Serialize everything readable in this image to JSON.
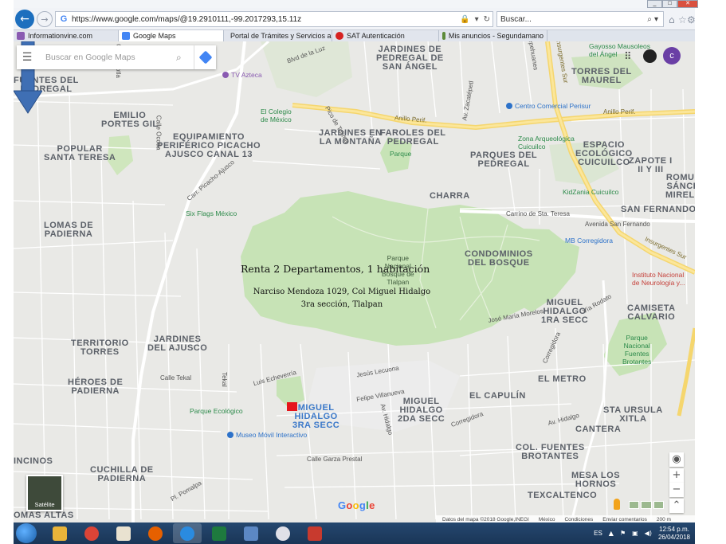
{
  "browser": {
    "url": "https://www.google.com/maps/@19.2910111,-99.2017293,15.11z",
    "search_placeholder": "Buscar...",
    "tabs": [
      {
        "label": "Informationvine.com",
        "color": "#8a5bb2"
      },
      {
        "label": "Google Maps",
        "color": "#4285f4"
      },
      {
        "label": "Portal de Trámites y Servicios a...",
        "color": "#6a85b8"
      },
      {
        "label": "SAT Autenticación",
        "color": "#d62222"
      },
      {
        "label": "Mis anuncios - Segundamano",
        "color": "#5d8b3a"
      }
    ],
    "active_tab": 1
  },
  "gmaps": {
    "search_placeholder": "Buscar en Google Maps",
    "avatar_letter": "c",
    "logo": "Google",
    "attribution": [
      "Datos del mapa ©2018 Google,INEGI",
      "México",
      "Condiciones",
      "Enviar comentarios",
      "200 m"
    ],
    "satellite_label": "Satélite"
  },
  "map": {
    "neighborhoods": [
      {
        "text": "JARDINES DE\nPEDREGAL DE\nSAN ÁNGEL"
      },
      {
        "text": "TORRES DEL\nMAUREL"
      },
      {
        "text": "FUENTES DEL\nPEDREGAL"
      },
      {
        "text": "EMILIO\nPORTES GIL"
      },
      {
        "text": "POPULAR\nSANTA TERESA"
      },
      {
        "text": "EQUIPAMIENTO\nPERIFÉRICO PICACHO\nAJUSCO CANAL 13"
      },
      {
        "text": "JARDINES EN\nLA MONTAÑA"
      },
      {
        "text": "FAROLES DEL\nPEDREGAL"
      },
      {
        "text": "PARQUES DEL\nPEDREGAL"
      },
      {
        "text": "ESPACIO\nECOLÓGICO\nCUICUILCO"
      },
      {
        "text": "ZAPOTE I\nII Y III"
      },
      {
        "text": "ROMUL\nSÁNCH\nMIRELE"
      },
      {
        "text": "CHARRA"
      },
      {
        "text": "SAN FERNANDO"
      },
      {
        "text": "LOMAS DE\nPADIERNA"
      },
      {
        "text": "CONDOMINIOS\nDEL BOSQUE"
      },
      {
        "text": "MIGUEL\nHIDALGO\n1RA SECC"
      },
      {
        "text": "CAMISETA\nCALVARIO"
      },
      {
        "text": "TERRITORIO\nTORRES"
      },
      {
        "text": "JARDINES\nDEL AJUSCO"
      },
      {
        "text": "HÉROES DE\nPADIERNA"
      },
      {
        "text": "EL METRO"
      },
      {
        "text": "EL CAPULÍN"
      },
      {
        "text": "MIGUEL\nHIDALGO\n2DA SECC"
      },
      {
        "text": "STA URSULA\nXITLA"
      },
      {
        "text": "CUCHILLA DE\nPADIERNA"
      },
      {
        "text": "CANTERA"
      },
      {
        "text": "COL. FUENTES\nBROTANTES"
      },
      {
        "text": "MESA LOS\nHORNOS"
      },
      {
        "text": "TEXCALTENCO"
      },
      {
        "text": "INCINOS"
      },
      {
        "text": "OMAS ALTAS"
      }
    ],
    "selected_area": "MIGUEL\nHIDALGO\n3RA SECC",
    "pois": [
      {
        "text": "TV Azteca",
        "type": "purple"
      },
      {
        "text": "El Colegio\nde México",
        "type": "green"
      },
      {
        "text": "Centro Comercial Perisur",
        "type": "blue"
      },
      {
        "text": "Zona Arqueológica\nCuicuilco",
        "type": "green"
      },
      {
        "text": "Gayosso Mausoleos\ndel Ángel",
        "type": "green"
      },
      {
        "text": "Parque",
        "type": "green"
      },
      {
        "text": "Six Flags México",
        "type": "green"
      },
      {
        "text": "KidZania Cuicuilco",
        "type": "green"
      },
      {
        "text": "MB Corregidora",
        "type": "blue"
      },
      {
        "text": "Parque\nNacional\nBosque de\nTlalpan",
        "type": "dark"
      },
      {
        "text": "Instituto Nacional\nde Neurología y...",
        "type": "red"
      },
      {
        "text": "Parque\nNacional\nFuentes\nBrotantes",
        "type": "green"
      },
      {
        "text": "Parque Ecológico",
        "type": "green"
      },
      {
        "text": "Museo Móvil Interactivo",
        "type": "blue"
      }
    ],
    "roads": [
      "Insurgentes Sur",
      "Anillo Perif.",
      "Anillo Perif.",
      "Carr. Picacho-Ajusco",
      "Carrino de Sta. Teresa",
      "Avenida San Fernando",
      "Insurgentes Sur",
      "Luis Echeverría",
      "Jesús Lecuona",
      "Felipe Villanueva",
      "Calle Tekal",
      "Tekal",
      "Corregidora",
      "Av. Hidalgo",
      "Calle Ocotla",
      "Calle Garza Prestal",
      "Corregidora",
      "Av. Zacatépetl",
      "Blvd de la Luz",
      "Pico de Tolima",
      "Av. Hidalgo",
      "Vía Rodato",
      "José María Morelos",
      "Tepehuanes",
      "Carr. Ocotla",
      "Pl. Pomalpa"
    ]
  },
  "annotation": {
    "title": "Renta 2 Departamentos, 1 habitación",
    "address_line1": "Narciso Mendoza  1029, Col  Miguel Hidalgo",
    "address_line2": "3ra sección, Tlalpan"
  },
  "taskbar": {
    "language": "ES",
    "time": "12:54 p.m.",
    "date": "26/04/2018",
    "apps": [
      {
        "name": "explorer",
        "color": "#e8b43a"
      },
      {
        "name": "chrome",
        "color": "#db4437"
      },
      {
        "name": "media",
        "color": "#e9e2d0"
      },
      {
        "name": "firefox",
        "color": "#e66000"
      },
      {
        "name": "ie",
        "color": "#2a8be0"
      },
      {
        "name": "excel",
        "color": "#1e7a3e"
      },
      {
        "name": "window",
        "color": "#5c88c4"
      },
      {
        "name": "itunes",
        "color": "#e0e0e8"
      },
      {
        "name": "chart",
        "color": "#c83a2e"
      }
    ]
  }
}
